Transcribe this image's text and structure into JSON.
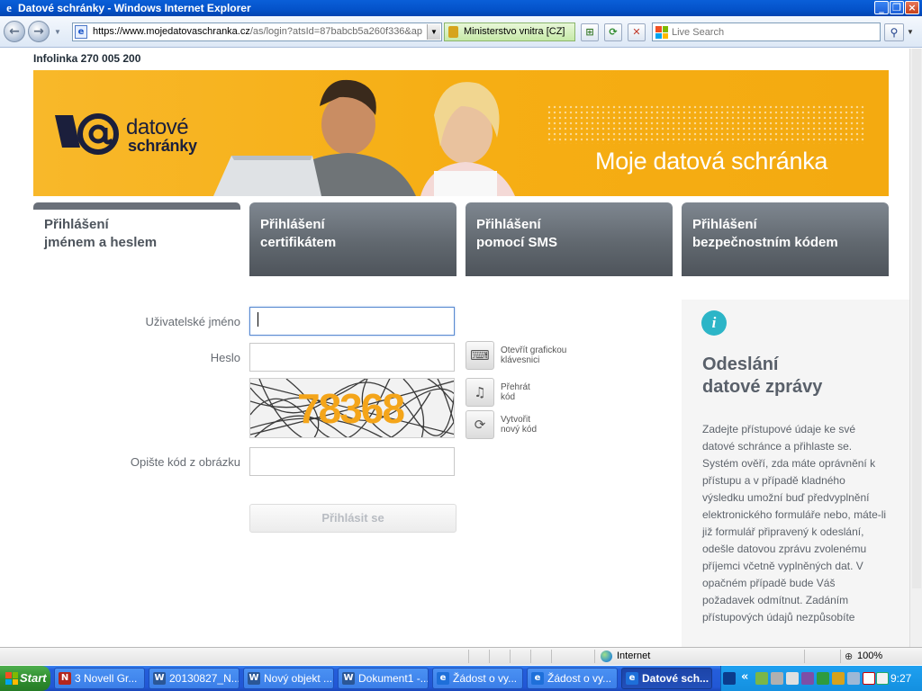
{
  "window": {
    "title": "Datové schránky - Windows Internet Explorer",
    "minimize": "_",
    "maximize": "❐",
    "close": "×"
  },
  "browser": {
    "url_host": "https://www.mojedatovaschranka.cz",
    "url_rest": "/as/login?atsId=87babcb5a260f336&ap",
    "security_label": "Ministerstvo vnitra [CZ]",
    "search_placeholder": "Live Search",
    "status_zone": "Internet",
    "zoom": "100%"
  },
  "page": {
    "infolinka": "Infolinka 270 005 200",
    "banner": {
      "logo_line1": "datové",
      "logo_line2": "schránky",
      "tagline": "Moje datová schránka",
      "colors": {
        "banner": "#f6ae14",
        "logo": "#1b1f3c"
      }
    },
    "tabs": [
      {
        "line1": "Přihlášení",
        "line2": "jménem a heslem",
        "active": true
      },
      {
        "line1": "Přihlášení",
        "line2": "certifikátem",
        "active": false
      },
      {
        "line1": "Přihlášení",
        "line2": "pomocí SMS",
        "active": false
      },
      {
        "line1": "Přihlášení",
        "line2": "bezpečnostním kódem",
        "active": false
      }
    ],
    "form": {
      "username_label": "Uživatelské jméno",
      "username_value": "",
      "password_label": "Heslo",
      "password_value": "",
      "keyboard_label_1": "Otevřít grafickou",
      "keyboard_label_2": "klávesnici",
      "audio_label_1": "Přehrát",
      "audio_label_2": "kód",
      "refresh_label_1": "Vytvořit",
      "refresh_label_2": "nový kód",
      "captcha_code": "78368",
      "captcha_label": "Opište kód z obrázku",
      "captcha_value": "",
      "submit_label": "Přihlásit se"
    },
    "info": {
      "icon": "i",
      "heading_1": "Odeslání",
      "heading_2": "datové zprávy",
      "body": "Zadejte přístupové údaje ke své datové schránce a přihlaste se. Systém ověří, zda máte oprávnění k přístupu a v případě kladného výsledku umožní buď předvyplnění elektronického formuláře nebo, máte-li již formulář připravený k odeslání, odešle datovou zprávu zvolenému příjemci včetně vyplněných dat. V opačném případě bude Váš požadavek odmítnut. Zadáním přístupových údajů nezpůsobíte"
    }
  },
  "taskbar": {
    "start_label": "Start",
    "items": [
      {
        "label": "3 Novell Gr...",
        "icon": "novell-icon",
        "active": false
      },
      {
        "label": "20130827_N...",
        "icon": "word-icon",
        "active": false
      },
      {
        "label": "Nový objekt ...",
        "icon": "word-icon",
        "active": false
      },
      {
        "label": "Dokument1 -...",
        "icon": "word-icon",
        "active": false
      },
      {
        "label": "Žádost o vy...",
        "icon": "ie-icon",
        "active": false
      },
      {
        "label": "Žádost o vy...",
        "icon": "ie-icon",
        "active": false
      },
      {
        "label": "Datové sch...",
        "icon": "ie-icon",
        "active": true
      }
    ],
    "clock": "9:27"
  }
}
